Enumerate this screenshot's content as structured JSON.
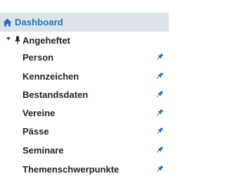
{
  "nav": {
    "dashboard": {
      "label": "Dashboard",
      "icon": "home-icon",
      "color": "#1a73c1"
    },
    "pinned_group": {
      "label": "Angeheftet",
      "icon": "pin-icon",
      "expanded": true,
      "items": [
        {
          "label": "Person",
          "icon": "pin-icon"
        },
        {
          "label": "Kennzeichen",
          "icon": "pin-icon"
        },
        {
          "label": "Bestandsdaten",
          "icon": "pin-icon"
        },
        {
          "label": "Vereine",
          "icon": "pin-icon"
        },
        {
          "label": "Pässe",
          "icon": "pin-icon"
        },
        {
          "label": "Seminare",
          "icon": "pin-icon"
        },
        {
          "label": "Themenschwerpunkte",
          "icon": "pin-icon"
        }
      ]
    },
    "pin_color": "#1a73c1"
  }
}
